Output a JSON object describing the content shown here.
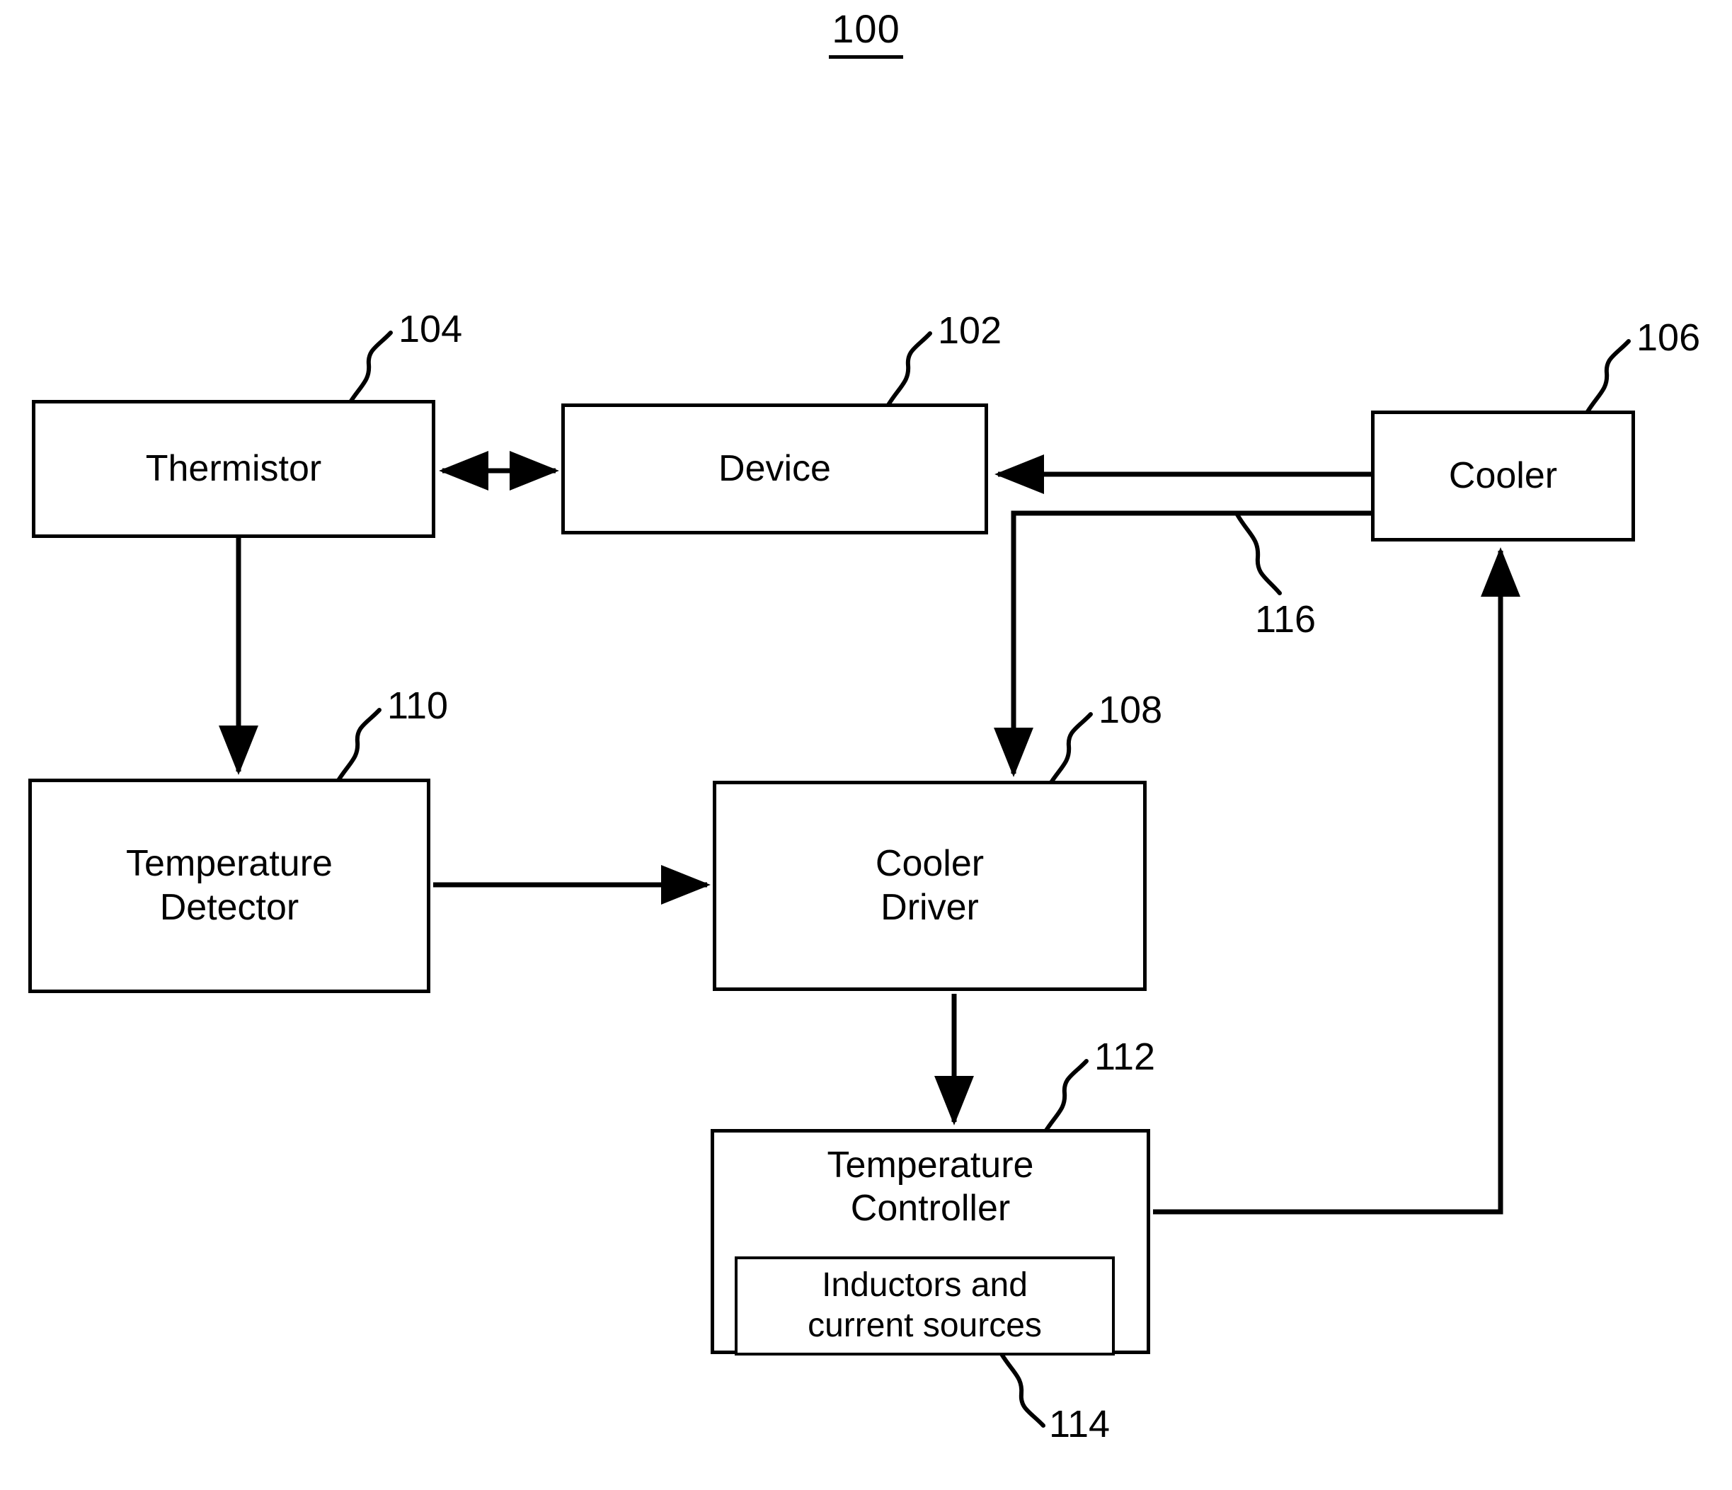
{
  "figure": {
    "number": "100"
  },
  "blocks": [
    {
      "id": "thermistor",
      "label": "Thermistor",
      "ref": "104"
    },
    {
      "id": "device",
      "label": "Device",
      "ref": "102"
    },
    {
      "id": "cooler",
      "label": "Cooler",
      "ref": "106"
    },
    {
      "id": "temperature_detector",
      "label": "Temperature\nDetector",
      "ref": "110"
    },
    {
      "id": "cooler_driver",
      "label": "Cooler\nDriver",
      "ref": "108"
    },
    {
      "id": "temperature_controller",
      "label": "Temperature\nController",
      "ref": "112"
    },
    {
      "id": "inductors",
      "label": "Inductors and\ncurrent sources",
      "ref": "114"
    }
  ],
  "refs": {
    "thermistor": "104",
    "device": "102",
    "cooler": "106",
    "cooler_feedback_line": "116",
    "temperature_detector": "110",
    "cooler_driver": "108",
    "temperature_controller": "112",
    "inductors": "114"
  },
  "colors": {
    "line": "#000000",
    "background": "#ffffff",
    "text": "#000000"
  },
  "connections": [
    {
      "from": "thermistor",
      "to": "device",
      "arrow": "both"
    },
    {
      "from": "cooler",
      "to": "device",
      "arrow": "single"
    },
    {
      "from": "thermistor",
      "to": "temperature_detector",
      "arrow": "single"
    },
    {
      "from": "temperature_detector",
      "to": "cooler_driver",
      "arrow": "single"
    },
    {
      "from": "cooler",
      "to": "cooler_driver",
      "arrow": "single",
      "ref": "116"
    },
    {
      "from": "cooler_driver",
      "to": "temperature_controller",
      "arrow": "single"
    },
    {
      "from": "temperature_controller",
      "to": "cooler",
      "arrow": "single"
    }
  ]
}
